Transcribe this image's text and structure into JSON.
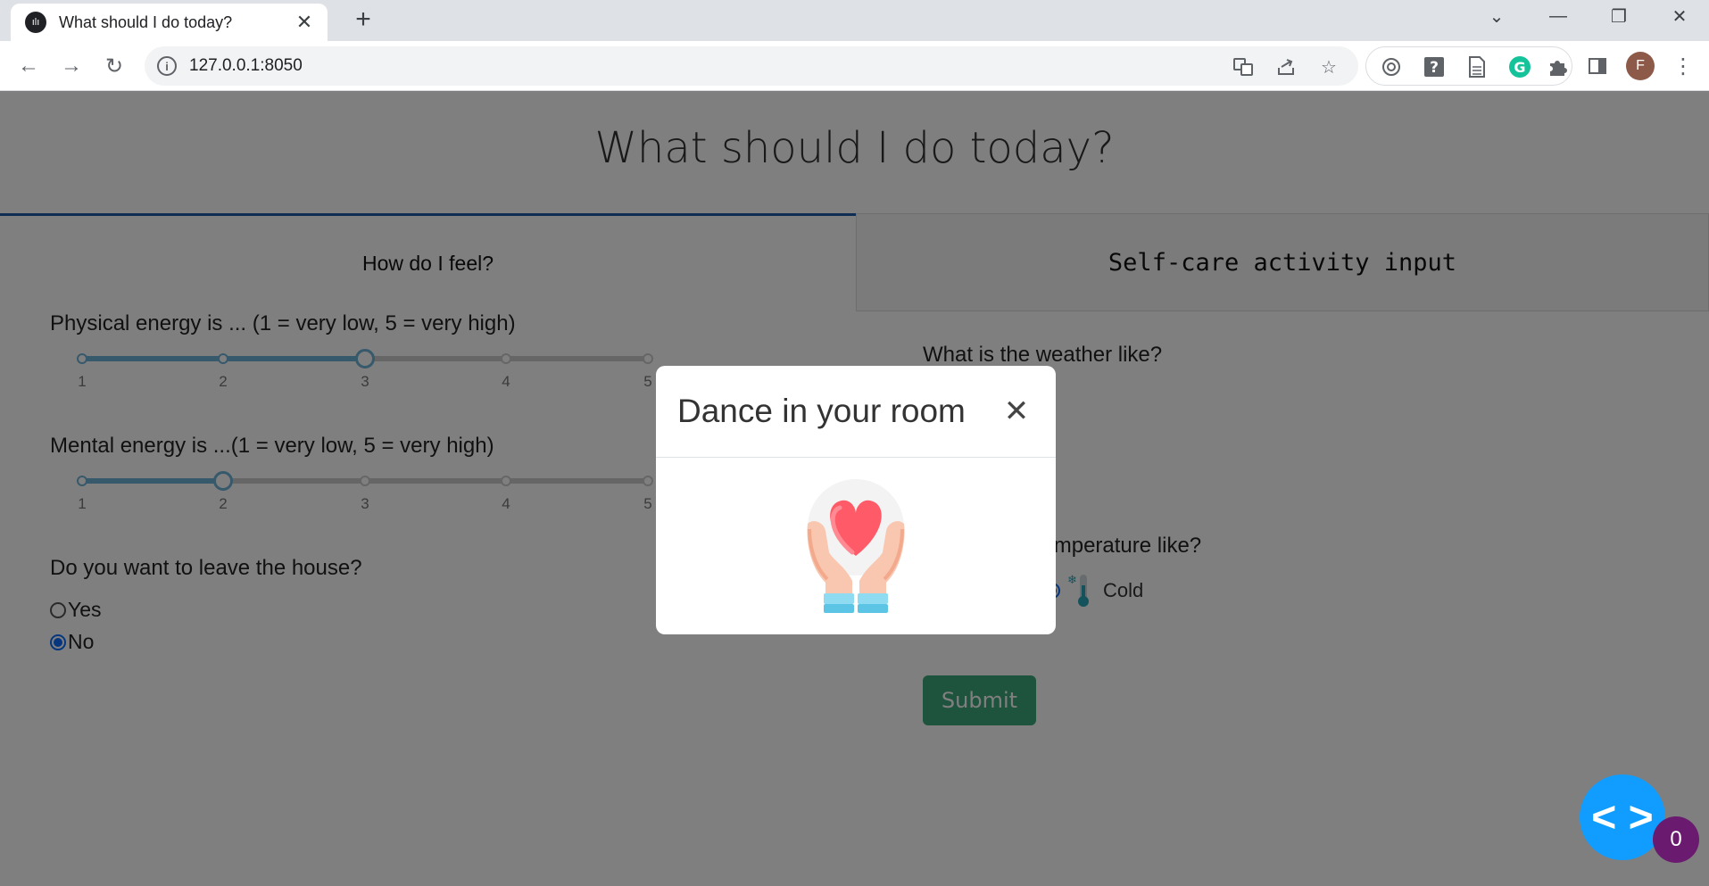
{
  "browser": {
    "tab_title": "What should I do today?",
    "tab_close": "✕",
    "new_tab": "+",
    "url": "127.0.0.1:8050",
    "profile_initial": "F",
    "window_controls": [
      "⌄",
      "—",
      "❐",
      "✕"
    ]
  },
  "page": {
    "title": "What should I do today?",
    "tabs": [
      {
        "label": "How do I feel?",
        "selected": true
      },
      {
        "label": "Self-care activity input",
        "selected": false
      }
    ]
  },
  "feel": {
    "physical": {
      "label": "Physical energy is ... (1 = very low, 5 = very high)",
      "value": 3,
      "marks": [
        "1",
        "2",
        "3",
        "4",
        "5"
      ]
    },
    "mental": {
      "label": "Mental energy is ...(1 = very low, 5 = very high)",
      "value": 2,
      "marks": [
        "1",
        "2",
        "3",
        "4",
        "5"
      ]
    },
    "leave_house": {
      "label": "Do you want to leave the house?",
      "options": [
        {
          "label": "Yes",
          "checked": false
        },
        {
          "label": "No",
          "checked": true
        }
      ]
    }
  },
  "activity": {
    "weather_label": "What is the weather like?",
    "temperature_label": "What is the temperature like?",
    "temperature_option": "Cold",
    "submit_label": "Submit"
  },
  "modal": {
    "title": "Dance in your room",
    "close": "✕",
    "image_icon": "hands-holding-heart-icon"
  },
  "devtools": {
    "badge_count": "0",
    "button_glyph": "< >"
  },
  "colors": {
    "accent": "#1f5aa6",
    "slider": "#6fb2d8",
    "submit": "#3ca67a",
    "devtools": "#119dff",
    "badge": "#6a1b6f"
  }
}
